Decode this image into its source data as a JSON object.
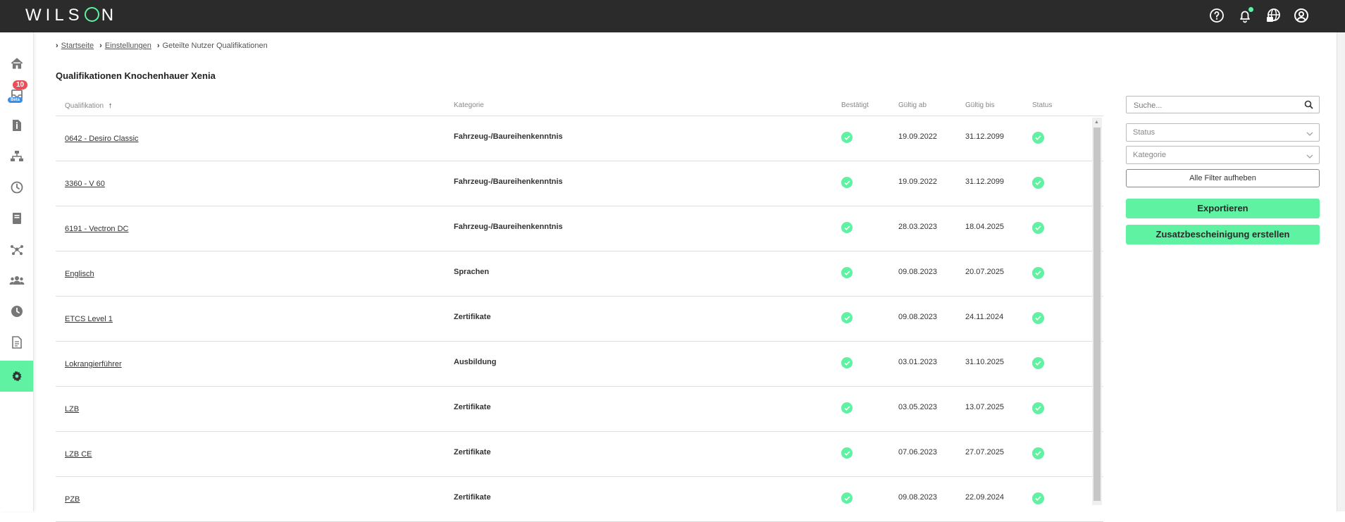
{
  "app": {
    "logo_text_1": "WILS",
    "logo_text_2": "N"
  },
  "header": {
    "icons": [
      "help-icon",
      "bell-icon",
      "globe-icon",
      "account-icon"
    ]
  },
  "sidebar": {
    "items": [
      {
        "icon": "home-icon"
      },
      {
        "icon": "inbox-icon",
        "badge_count": "10",
        "badge_label": "Beta"
      },
      {
        "icon": "document-info-icon"
      },
      {
        "icon": "network-icon"
      },
      {
        "icon": "clock-icon"
      },
      {
        "icon": "book-icon"
      },
      {
        "icon": "nodes-icon"
      },
      {
        "icon": "users-icon"
      },
      {
        "icon": "history-icon"
      },
      {
        "icon": "file-icon"
      },
      {
        "icon": "gear-icon",
        "active": true
      }
    ]
  },
  "breadcrumb": {
    "home": "Startseite",
    "settings": "Einstellungen",
    "current": "Geteilte Nutzer Qualifikationen"
  },
  "page": {
    "title": "Qualifikationen Knochenhauer Xenia"
  },
  "table": {
    "columns": {
      "qualifikation": "Qualifikation",
      "kategorie": "Kategorie",
      "bestaetigt": "Bestätigt",
      "gueltig_ab": "Gültig ab",
      "gueltig_bis": "Gültig bis",
      "status": "Status"
    },
    "rows": [
      {
        "qualifikation": "0642 - Desiro Classic",
        "kategorie": "Fahrzeug-/Baureihenkenntnis",
        "gueltig_ab": "19.09.2022",
        "gueltig_bis": "31.12.2099"
      },
      {
        "qualifikation": "3360 - V 60",
        "kategorie": "Fahrzeug-/Baureihenkenntnis",
        "gueltig_ab": "19.09.2022",
        "gueltig_bis": "31.12.2099"
      },
      {
        "qualifikation": "6191 - Vectron DC",
        "kategorie": "Fahrzeug-/Baureihenkenntnis",
        "gueltig_ab": "28.03.2023",
        "gueltig_bis": "18.04.2025"
      },
      {
        "qualifikation": "Englisch",
        "kategorie": "Sprachen",
        "gueltig_ab": "09.08.2023",
        "gueltig_bis": "20.07.2025"
      },
      {
        "qualifikation": "ETCS Level 1",
        "kategorie": "Zertifikate",
        "gueltig_ab": "09.08.2023",
        "gueltig_bis": "24.11.2024"
      },
      {
        "qualifikation": "Lokrangierführer",
        "kategorie": "Ausbildung",
        "gueltig_ab": "03.01.2023",
        "gueltig_bis": "31.10.2025"
      },
      {
        "qualifikation": "LZB",
        "kategorie": "Zertifikate",
        "gueltig_ab": "03.05.2023",
        "gueltig_bis": "13.07.2025"
      },
      {
        "qualifikation": "LZB CE",
        "kategorie": "Zertifikate",
        "gueltig_ab": "07.06.2023",
        "gueltig_bis": "27.07.2025"
      },
      {
        "qualifikation": "PZB",
        "kategorie": "Zertifikate",
        "gueltig_ab": "09.08.2023",
        "gueltig_bis": "22.09.2024"
      }
    ]
  },
  "filters": {
    "search_placeholder": "Suche...",
    "status_placeholder": "Status",
    "kategorie_placeholder": "Kategorie",
    "clear_label": "Alle Filter aufheben",
    "export_label": "Exportieren",
    "certificate_label": "Zusatzbescheinigung erstellen"
  },
  "colors": {
    "accent": "#5ef2a2",
    "topbar": "#2b2b2b",
    "badge_red": "#e94e5a",
    "badge_blue": "#3b8ee8"
  }
}
